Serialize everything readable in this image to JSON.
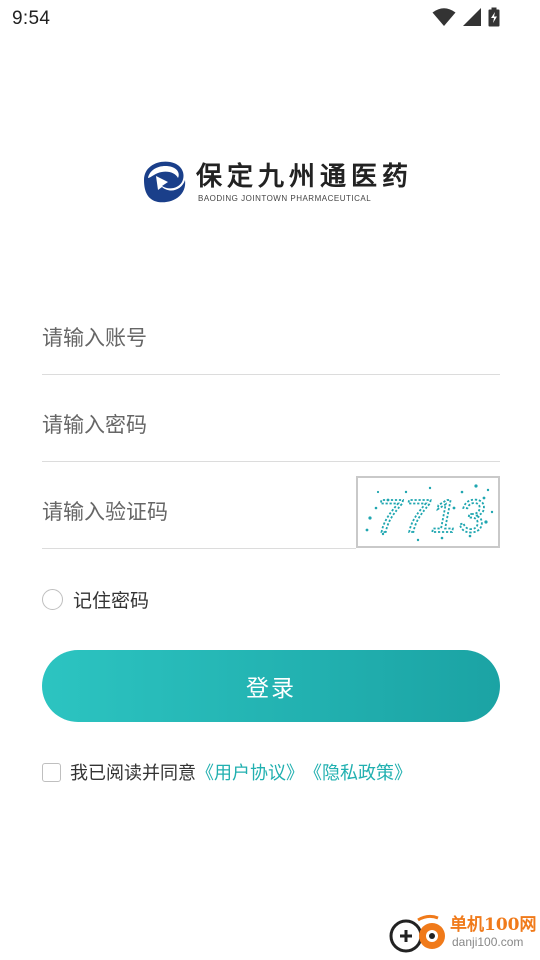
{
  "status_bar": {
    "time": "9:54",
    "icons": [
      "wifi-icon",
      "signal-icon",
      "battery-charging-icon"
    ]
  },
  "logo": {
    "name_cn": "保定九州通医药",
    "name_en": "BAODING JOINTOWN PHARMACEUTICAL",
    "brand_color": "#1a3f8a"
  },
  "form": {
    "account_placeholder": "请输入账号",
    "account_value": "",
    "password_placeholder": "请输入密码",
    "password_value": "",
    "captcha_placeholder": "请输入验证码",
    "captcha_value": "",
    "captcha_image_text": "7713",
    "remember_label": "记住密码",
    "remember_checked": false,
    "login_label": "登录",
    "accent_color": "#22b4b3"
  },
  "agreement": {
    "prefix": "我已阅读并同意",
    "user_agreement": "《用户协议》",
    "privacy_policy": "《隐私政策》",
    "checked": false
  },
  "watermark": {
    "name_cn": "单机100网",
    "domain": "danji100.com"
  }
}
